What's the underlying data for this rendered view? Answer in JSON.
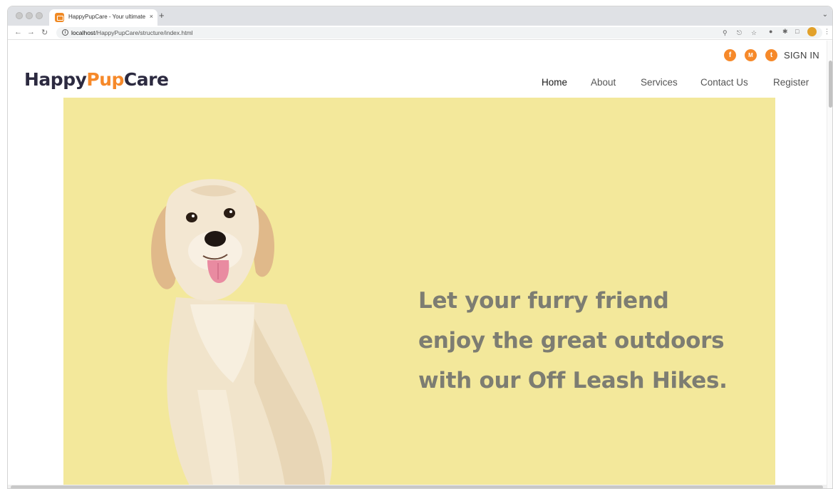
{
  "browser": {
    "tab_title": "HappyPupCare - Your ultimate",
    "tab_close": "×",
    "new_tab": "+",
    "url_host": "localhost",
    "url_path": "/HappyPupCare/structure/index.html"
  },
  "header": {
    "logo_part1": "Happy",
    "logo_part2": "Pup",
    "logo_part3": "Care",
    "social": [
      {
        "icon": "facebook-icon",
        "glyph": "f"
      },
      {
        "icon": "mail-icon",
        "glyph": "M"
      },
      {
        "icon": "twitter-icon",
        "glyph": "t"
      }
    ],
    "sign_in": "SIGN IN",
    "nav": [
      "Home",
      "About",
      "Services",
      "Contact Us",
      "Register"
    ],
    "active_nav": "Home"
  },
  "hero": {
    "headline": [
      "Let your furry friend",
      "enjoy the great outdoors",
      "with our Off Leash Hikes."
    ],
    "background": "#f3e89b"
  },
  "colors": {
    "accent": "#f6892a",
    "logo_dark": "#2c2a40",
    "headline": "#7d7d72"
  }
}
